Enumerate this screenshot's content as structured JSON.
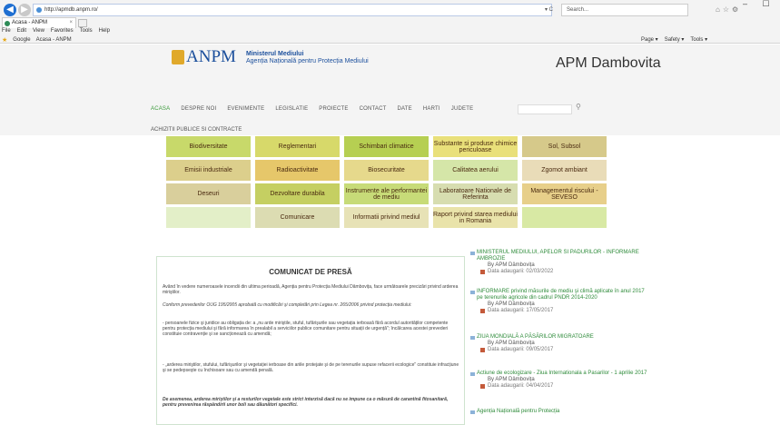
{
  "browser": {
    "address": "http://apmdb.anpm.ro/",
    "address_controls": "▾ C",
    "search_placeholder": "Search...",
    "tab_title": "Acasa - ANPM",
    "tab_close": "×",
    "menu": [
      "File",
      "Edit",
      "View",
      "Favorites",
      "Tools",
      "Help"
    ],
    "favorites": [
      "Google",
      "Acasa - ANPM"
    ],
    "command_bar": [
      "Page ▾",
      "Safety ▾",
      "Tools ▾"
    ],
    "window_controls": "– ☐"
  },
  "header": {
    "logo": "ANPM",
    "ministry": "Ministerul Mediului",
    "agency": "Agenția Națională pentru Protecția Mediului",
    "site_title": "APM Dambovita"
  },
  "nav": {
    "items": [
      "ACASA",
      "DESPRE NOI",
      "EVENIMENTE",
      "LEGISLATIE",
      "PROIECTE",
      "CONTACT",
      "DATE",
      "HARTI",
      "JUDETE"
    ],
    "sub": "ACHIZITII PUBLICE SI CONTRACTE"
  },
  "tiles": [
    {
      "label": "Biodiversitate",
      "color": "#c8d96a"
    },
    {
      "label": "Reglementari",
      "color": "#d7d96a"
    },
    {
      "label": "Schimbari climatice",
      "color": "#b6cf52"
    },
    {
      "label": "Substante si produse chimice periculoase",
      "color": "#e9e07a"
    },
    {
      "label": "Sol, Subsol",
      "color": "#d6c98a"
    },
    {
      "label": "Emisii industriale",
      "color": "#dccf8c"
    },
    {
      "label": "Radioactivitate",
      "color": "#e6c76a"
    },
    {
      "label": "Biosecuritate",
      "color": "#e6d98c"
    },
    {
      "label": "Calitatea aerului",
      "color": "#d5e6a8"
    },
    {
      "label": "Zgomot ambiant",
      "color": "#e9dcb8"
    },
    {
      "label": "Deseuri",
      "color": "#d9cf9c"
    },
    {
      "label": "Dezvoltare durabila",
      "color": "#c5cf62"
    },
    {
      "label": "Instrumente ale performantei de mediu",
      "color": "#c7db78"
    },
    {
      "label": "Laboratoare Nationale de Referinta",
      "color": "#d7ddb0"
    },
    {
      "label": "Managementul riscului - SEVESO",
      "color": "#e7cf8a"
    },
    {
      "label": "",
      "color": "#e3efc8"
    },
    {
      "label": "Comunicare",
      "color": "#dcdcb2"
    },
    {
      "label": "Informatii privind mediul",
      "color": "#e7e2b6"
    },
    {
      "label": "Raport privind starea mediului in Romania",
      "color": "#e9e3aa"
    },
    {
      "label": "",
      "color": "#d8e9a4"
    }
  ],
  "press": {
    "title": "COMUNICAT DE PRESĂ",
    "p1": "Având în vedere numeroasele incendii din ultima perioadă, Agenția pentru Protecția Mediului Dâmbovița, face următoarele precizări privind arderea miriştilor.",
    "p2": "Conform prevederilor OUG 195/2005 aprobată cu modificări şi completări prin Legea nr. 265/2006 privind protecția mediului:",
    "p3": "- persoanele fizice şi juridice au obligația de: a „nu arde miriştile, stuful, tufărişurile sau vegetația ierboasă fără acordul autorităților competente pentru protecția mediului şi fără informarea în prealabil a serviciilor publice comunitare pentru situații de urgență\"; încălcarea acestei prevederi constituie contravenție şi se sancționează cu amendă;",
    "p4": "- „arderea miriştilor, stufului, tufărişurilor şi vegetației ierboase din ariile protejate şi de pe terenurile supuse refacerii ecologice\" constituie infracțiune şi se pedepseşte cu închisoare sau cu amendă penală.",
    "p5": "De asemenea, arderea miriştilor şi a resturilor vegetale este strict interzisă dacă nu se impune ca o măsură de carantină fitosanitară, pentru prevenirea răspândirii unor boli sau dăunători specifici."
  },
  "news": [
    {
      "title": "MINISTERUL MEDIULUI, APELOR SI PADURILOR - INFORMARE AMBROZIE",
      "by": "By APM Dâmbovița",
      "date": "Data adaugarii: 02/03/2022"
    },
    {
      "title": "INFORMARE privind măsurile de mediu şi climă aplicate în anul 2017 pe terenurile agricole din cadrul PNDR 2014-2020",
      "by": "By APM Dâmbovița",
      "date": "Data adaugarii: 17/05/2017"
    },
    {
      "title": "ZIUA MONDIALĂ A PĂSĂRILOR MIGRATOARE",
      "by": "By APM Dâmbovița",
      "date": "Data adaugarii: 09/05/2017"
    },
    {
      "title": "Actiune de ecologizare - Ziua Internationala a Pasarilor - 1 aprilie 2017",
      "by": "By APM Dâmbovița",
      "date": "Data adaugarii: 04/04/2017"
    },
    {
      "title": "Agenția Națională pentru Protecția",
      "by": "",
      "date": ""
    }
  ]
}
